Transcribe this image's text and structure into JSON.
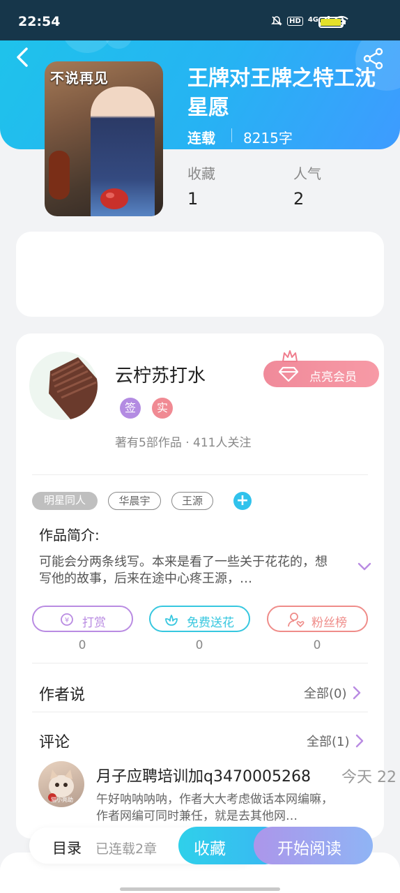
{
  "status_bar": {
    "time": "22:54",
    "icons": [
      "mute-icon",
      "hd-icon",
      "4g-signal-icon",
      "wifi-icon",
      "battery-icon"
    ],
    "network": "4G",
    "hd": "HD",
    "battery_level": 0.9
  },
  "header": {
    "back_icon": "chevron-left-icon",
    "share_icon": "share-icon"
  },
  "book": {
    "cover_title": "不说再见",
    "title": "王牌对王牌之特工沈星愿",
    "status": "连载",
    "word_count": "8215字",
    "stats": [
      {
        "label": "收藏",
        "value": "1"
      },
      {
        "label": "人气",
        "value": "2"
      }
    ]
  },
  "author": {
    "name": "云柠苏打水",
    "badges": [
      {
        "text": "签",
        "color": "#b38be2"
      },
      {
        "text": "实",
        "color": "#f08a93"
      }
    ],
    "meta": "著有5部作品 · 411人关注",
    "vip_button": "点亮会员"
  },
  "tags": [
    "明星同人",
    "华晨宇",
    "王源"
  ],
  "intro": {
    "label": "作品简介:",
    "text": "可能会分两条线写。本来是看了一些关于花花的，想写他的故事，后来在途中心疼王源，…"
  },
  "actions": [
    {
      "label": "打赏",
      "icon": "yen-coin-icon",
      "count": "0",
      "color": "#b98be2"
    },
    {
      "label": "免费送花",
      "icon": "flower-icon",
      "count": "0",
      "color": "#37c7df"
    },
    {
      "label": "粉丝榜",
      "icon": "fan-user-icon",
      "count": "0",
      "color": "#ef8c89"
    }
  ],
  "author_says": {
    "title": "作者说",
    "more": "全部(0)"
  },
  "comments": {
    "title": "评论",
    "more": "全部(1)",
    "items": [
      {
        "user": "月子应聘培训加q3470005268",
        "date": "今天  22",
        "text": "午好呐呐呐呐，作者大大考虑做话本网编嘛，作者网编可同时兼任，就是去其他网…",
        "avatar_caption": "猫小亮助"
      }
    ]
  },
  "bottom_bar": {
    "toc_label": "目录",
    "chapters": "已连载2章",
    "favorite": "收藏",
    "read": "开始阅读"
  }
}
